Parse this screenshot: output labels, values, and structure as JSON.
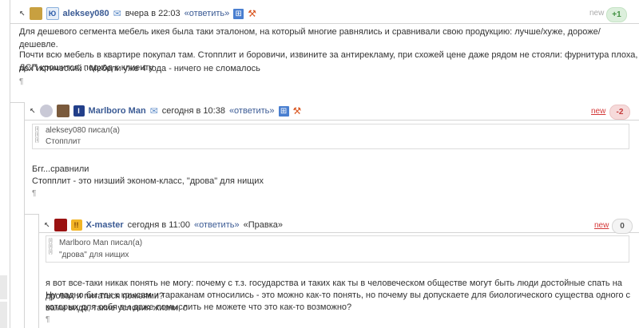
{
  "comments": [
    {
      "username": "aleksey080",
      "date": "вчера в 22:03",
      "reply": "«ответить»",
      "new_label": "new",
      "score": "+1",
      "lines": [
        "Для дешевого сегмента мебель икея была таки эталоном, на который многие равнялись и сравнивали свою продукцию: лучше/хуже, дороже/дешевле.",
        "Почти всю мебель в квартире покупал там. Стопплит и боровичи, извините за антирекламу, при схожей цене даже рядом не стояли: фурнитура плоха, ДСП крошится, подход к клиенту",
        "пох\"истический . Мебели уже 4 года - ничего не сломалось"
      ],
      "pilcrow": "¶"
    },
    {
      "username": "Marlboro Man",
      "date": "сегодня в 10:38",
      "reply": "«ответить»",
      "new_label": "new",
      "score": "-2",
      "quote_author": "aleksey080 писал(а)",
      "quote_text": "Стопплит",
      "lines": [
        "Бгг...сравнили",
        "Стопплит - это низший эконом-класс, \"дрова\" для нищих"
      ],
      "pilcrow": "¶"
    },
    {
      "username": "X-master",
      "date": "сегодня в 11:00",
      "reply": "«ответить»",
      "edit": "«Правка»",
      "new_label": "new",
      "score": "0",
      "quote_author": "Marlboro Man писал(а)",
      "quote_text": "\"дрова\" для нищих",
      "lines": [
        "я вот все-таки никак понять не могу: почему с т.з. государства и таких как ты в человеческом обществе могут быть люди достойные спать на дровах и питаться помоями?",
        "Ну ладно бы так к крысам и тараканам относились - это можно как-то понять, но почему вы допускаете для биологического существа одного с вами вида, такие условия жизни, о",
        "которых для себя вы даже помыслить не можете что это как-то возможно?"
      ],
      "pilcrow": "¶"
    }
  ],
  "colors": {
    "link": "#3a5a94",
    "new_red": "#d43838",
    "score_pos": "#3f8f3f",
    "score_neg": "#c43a3a"
  }
}
